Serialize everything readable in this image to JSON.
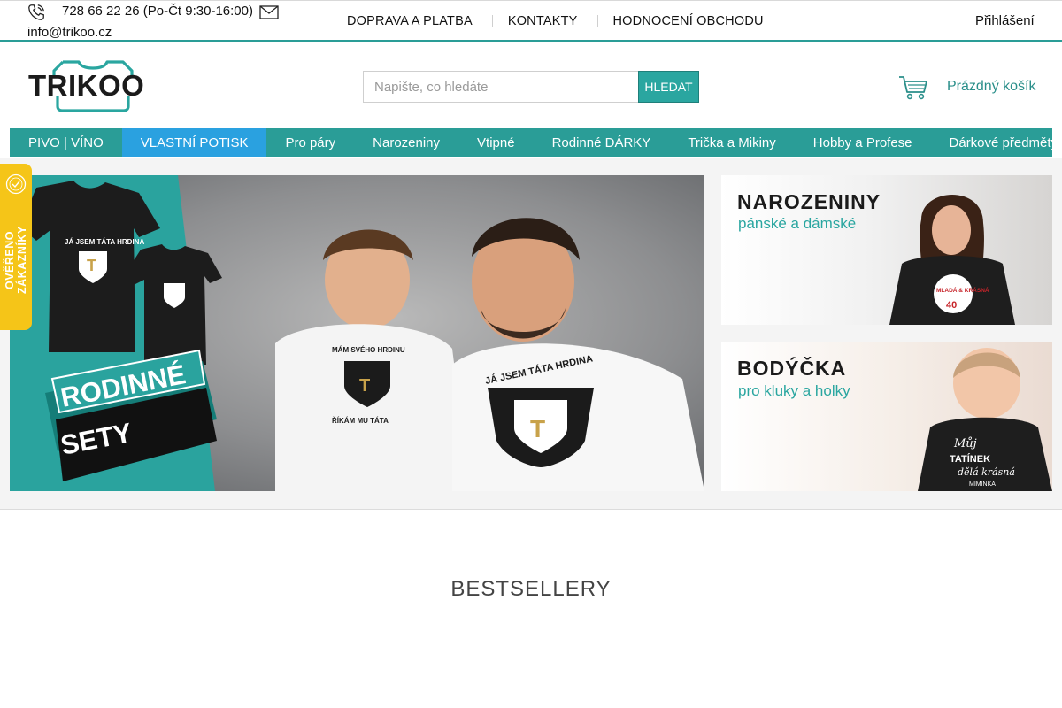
{
  "topbar": {
    "phone": "728 66 22 26 (Po-Čt 9:30-16:00)",
    "email": "info@trikoo.cz",
    "nav": [
      "DOPRAVA A PLATBA",
      "KONTAKTY",
      "HODNOCENÍ OBCHODU"
    ],
    "login": "Přihlášení"
  },
  "header": {
    "logo": "TRIKOO",
    "search_placeholder": "Napište, co hledáte",
    "search_button": "HLEDAT",
    "cart": "Prázdný košík"
  },
  "categories": [
    {
      "label": "PIVO | VÍNO",
      "active": false
    },
    {
      "label": "VLASTNÍ POTISK",
      "active": true
    },
    {
      "label": "Pro páry",
      "active": false
    },
    {
      "label": "Narozeniny",
      "active": false
    },
    {
      "label": "Vtipné",
      "active": false
    },
    {
      "label": "Rodinné DÁRKY",
      "active": false
    },
    {
      "label": "Trička a Mikiny",
      "active": false
    },
    {
      "label": "Hobby a Profese",
      "active": false
    },
    {
      "label": "Dárkové předměty",
      "active": false
    }
  ],
  "hero": {
    "line1": "RODINNÉ",
    "line2": "SETY",
    "shirt_big": "JÁ JSEM TÁTA HRDINA",
    "shirt_small_1": "MÁM SVÉHO HRDINU",
    "shirt_small_2": "ŘÍKÁM MU TÁTA",
    "shirt_letter": "T"
  },
  "side_banners": [
    {
      "title": "NAROZENINY",
      "subtitle": "pánské a dámské",
      "shirt_text": "MLADÁ & KRÁSNÁ",
      "shirt_number": "40"
    },
    {
      "title": "BODÝČKA",
      "subtitle": "pro kluky a holky",
      "shirt_text_1": "Můj",
      "shirt_text_2": "TATÍNEK",
      "shirt_text_3": "dělá krásná",
      "shirt_text_4": "MIMINKA"
    }
  ],
  "verified_badge": "OVĚŘENO ZÁKAZNÍKY",
  "section_title": "BESTSELLERY",
  "colors": {
    "brand_teal": "#2a9d97",
    "active_blue": "#2aa1e0",
    "badge_yellow": "#f5c518"
  },
  "icons": [
    "phone-icon",
    "mail-icon",
    "cart-icon"
  ]
}
